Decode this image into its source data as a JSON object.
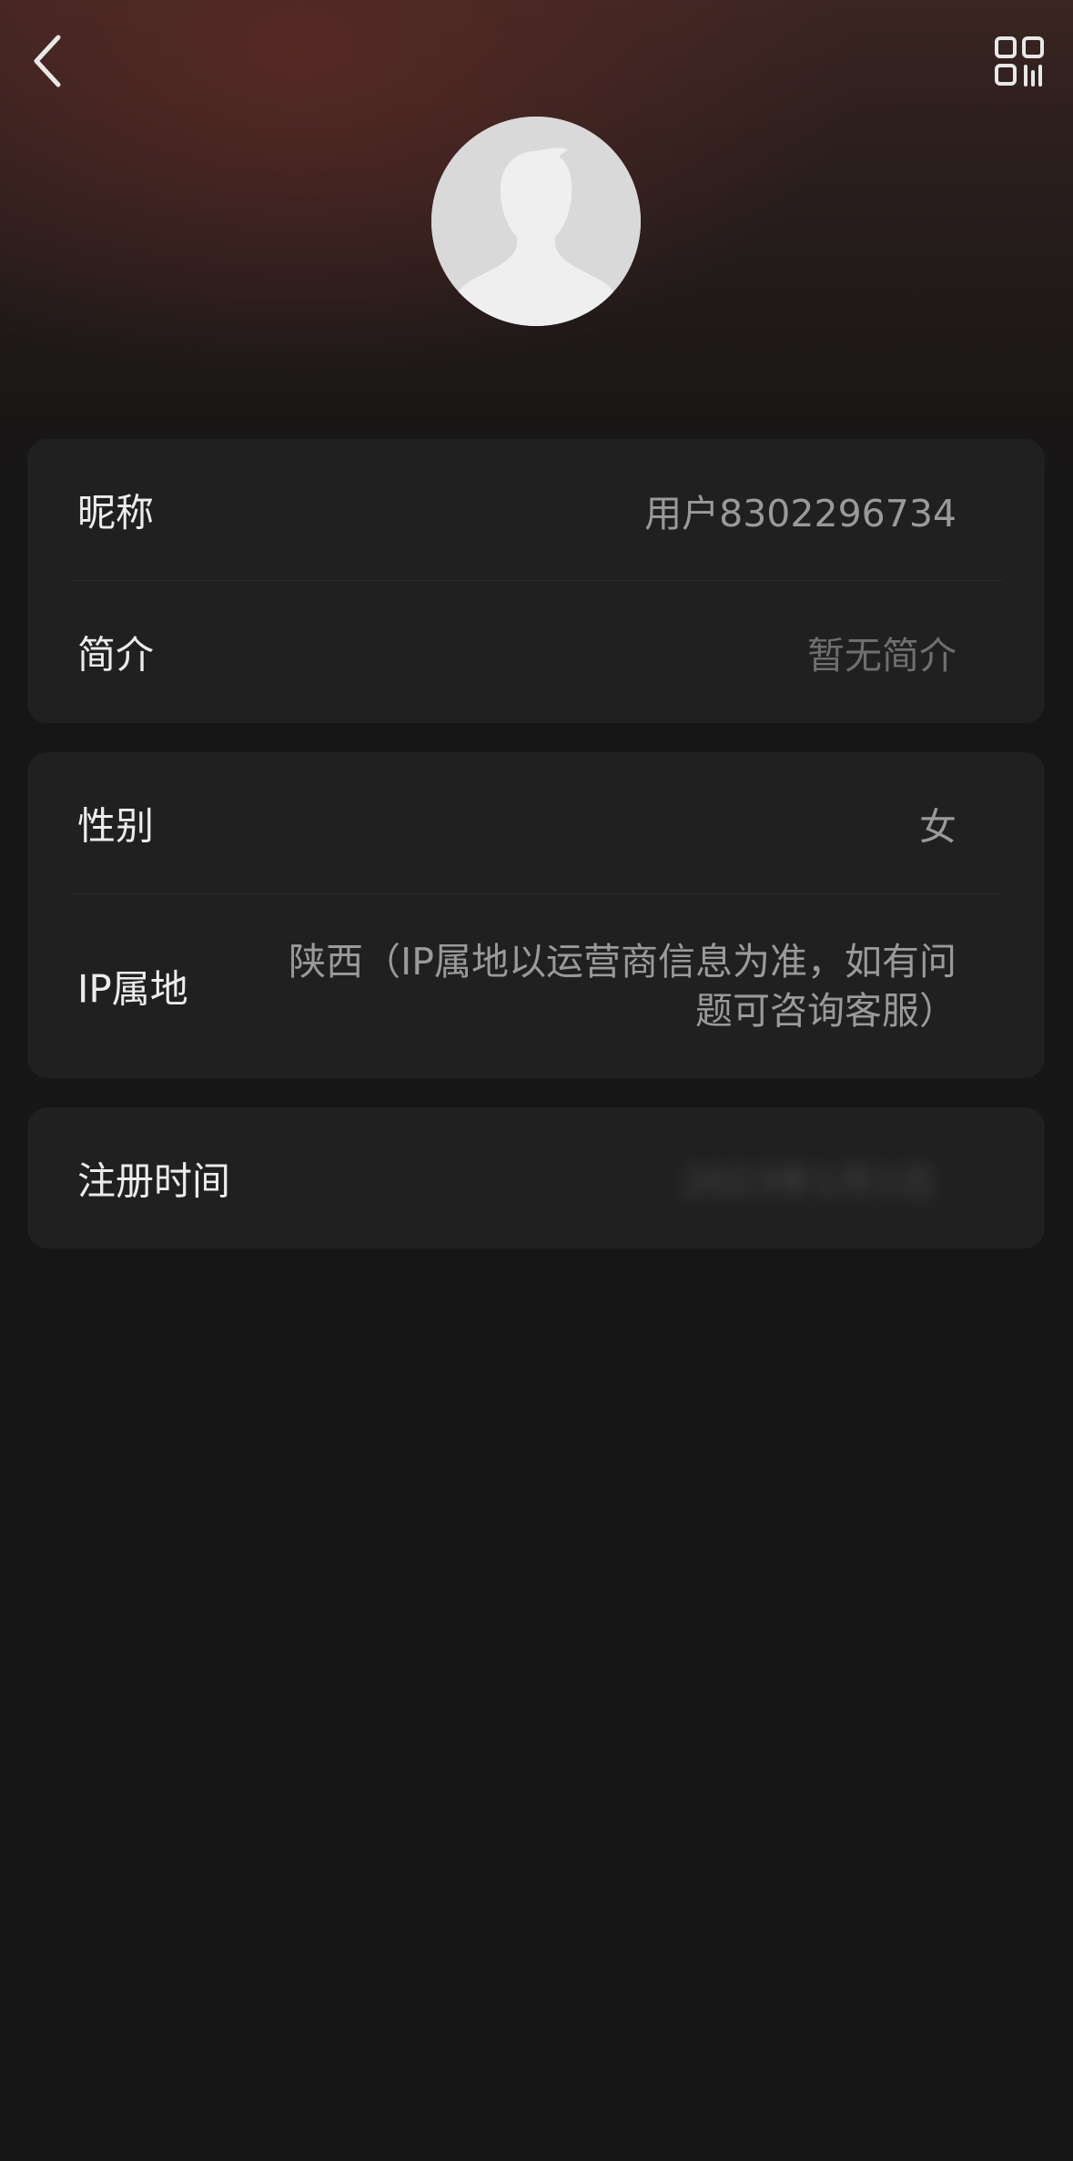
{
  "nav": {
    "back_icon": "chevron-left-icon",
    "qr_icon": "qr-code-icon"
  },
  "profile": {
    "avatar_icon": "default-user-avatar"
  },
  "basic_info": {
    "nickname_label": "昵称",
    "nickname_value": "用户8302296734",
    "bio_label": "简介",
    "bio_value": "暂无简介"
  },
  "details": {
    "gender_label": "性别",
    "gender_value": "女",
    "ip_label": "IP属地",
    "ip_value": "陕西（IP属地以运营商信息为准，如有问题可咨询客服）"
  },
  "registration": {
    "label": "注册时间",
    "value": "2023年1月1日"
  },
  "colors": {
    "background": "#161616",
    "card": "#202020",
    "header_tint": "#5c2a26"
  }
}
